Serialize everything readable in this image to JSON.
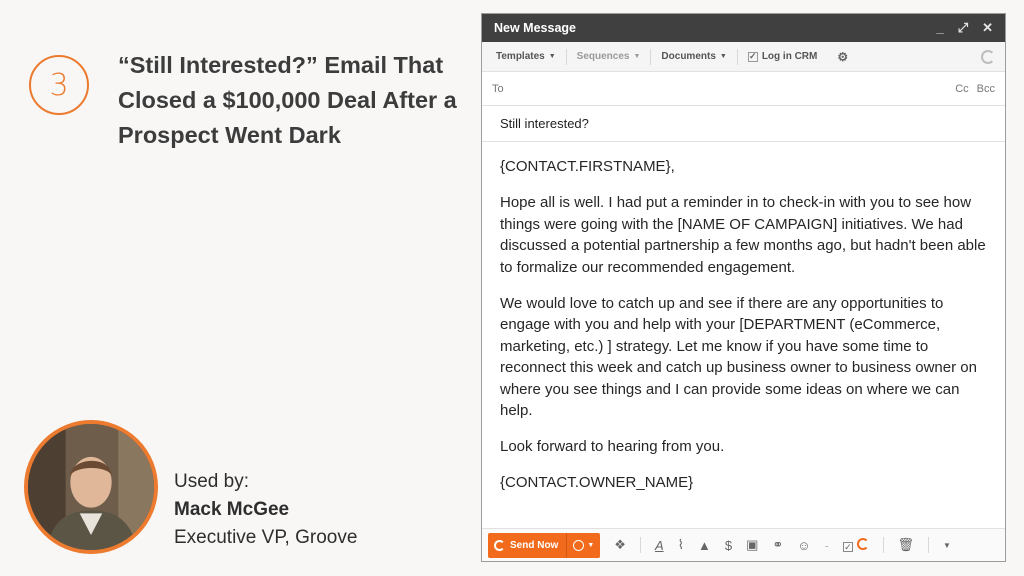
{
  "slide": {
    "step_number": "3",
    "headline": "“Still Interested?” Email That Closed a $100,000 Deal After a Prospect Went Dark",
    "used_by_label": "Used by:",
    "person_name": "Mack McGee",
    "person_title": "Executive VP, Groove"
  },
  "window": {
    "title": "New Message",
    "controls": [
      "_",
      "⤢",
      "✕"
    ]
  },
  "toolbar": {
    "templates": "Templates",
    "sequences": "Sequences",
    "documents": "Documents",
    "log_in_crm": "Log in CRM"
  },
  "fields": {
    "to_label": "To",
    "cc": "Cc",
    "bcc": "Bcc",
    "subject": "Still interested?"
  },
  "email_body": {
    "greeting": "{CONTACT.FIRSTNAME},",
    "p1": "Hope all is well. I had put a reminder in to check-in with you to see how things were going with the [NAME OF CAMPAIGN] initiatives. We had discussed a potential partnership a few months ago, but hadn't been able to formalize our recommended engagement.",
    "p2": "We would love to catch up and see if there are any opportunities to engage with you and help with your [DEPARTMENT (eCommerce, marketing, etc.) ] strategy. Let me know if you have some time to reconnect this week and catch up business owner to business owner on where you see things and I can provide some ideas on where we can help.",
    "p3": "Look forward to hearing from you.",
    "signature": "{CONTACT.OWNER_NAME}"
  },
  "bottombar": {
    "send_label": "Send Now"
  },
  "colors": {
    "accent": "#ec7a2f",
    "send_button": "#f26b1d",
    "titlebar": "#404040"
  }
}
